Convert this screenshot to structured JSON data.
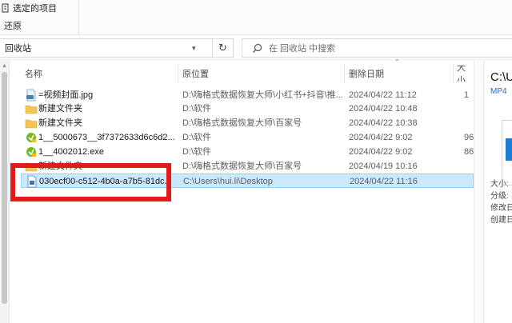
{
  "ribbon": {
    "select_label": "选定的项目",
    "restore_label": "还原"
  },
  "address": {
    "location": "回收站",
    "search_placeholder": "在 回收站 中搜索"
  },
  "columns": {
    "name": "名称",
    "original_location": "原位置",
    "date_deleted": "删除日期",
    "size": "大小"
  },
  "files": [
    {
      "name": "=视频封面.jpg",
      "location": "D:\\嗨格式数据恢复大师\\小红书+抖音\\推...",
      "date": "2024/04/22 11:12",
      "size": "1",
      "icon": "jpg-file-icon"
    },
    {
      "name": "新建文件夹",
      "location": "D:\\软件",
      "date": "2024/04/22 10:48",
      "size": "",
      "icon": "folder-icon"
    },
    {
      "name": "新建文件夹",
      "location": "D:\\嗨格式数据恢复大师\\百家号",
      "date": "2024/04/22 10:38",
      "size": "",
      "icon": "folder-icon"
    },
    {
      "name": "1__5000673__3f7372633d6c6d2...",
      "location": "D:\\软件",
      "date": "2024/04/22 9:02",
      "size": "96",
      "icon": "installer-icon"
    },
    {
      "name": "1__4002012.exe",
      "location": "D:\\软件",
      "date": "2024/04/22 9:02",
      "size": "86",
      "icon": "installer-icon"
    },
    {
      "name": "新建文件夹",
      "location": "D:\\嗨格式数据恢复大师\\百家号",
      "date": "2024/04/19 10:16",
      "size": "",
      "icon": "folder-icon"
    },
    {
      "name": "030ecf00-c512-4b0a-a7b5-81dc...",
      "location": "C:\\Users\\hui.li\\Desktop",
      "date": "2024/04/22 11:16",
      "size": "",
      "icon": "video-file-icon",
      "selected": true
    }
  ],
  "preview": {
    "title": "C:\\U",
    "subtitle": "MP4",
    "meta_size": "大小:",
    "meta_rating": "分级:",
    "meta_modified": "修改日",
    "meta_created": "创建日"
  },
  "colors": {
    "selection": "#cce8ff",
    "highlight": "#e21a1a",
    "folder": "#f4c453"
  }
}
